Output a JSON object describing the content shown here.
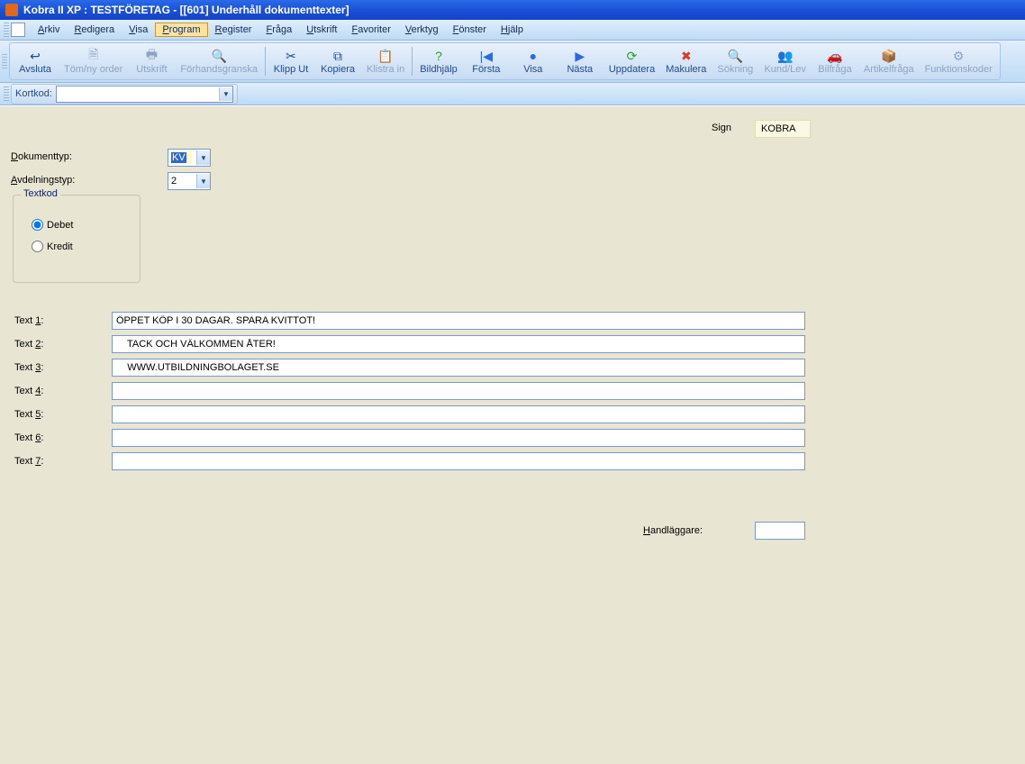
{
  "title": "Kobra II XP : TESTFÖRETAG - [[601] Underhåll dokumenttexter]",
  "menu": {
    "items": [
      "Arkiv",
      "Redigera",
      "Visa",
      "Program",
      "Register",
      "Fråga",
      "Utskrift",
      "Favoriter",
      "Verktyg",
      "Fönster",
      "Hjälp"
    ],
    "selected_index": 3
  },
  "toolbar": [
    {
      "label": "Avsluta",
      "icon": "↩",
      "disabled": false,
      "name": "avsluta"
    },
    {
      "label": "Töm/ny order",
      "icon": "🗎",
      "disabled": true,
      "name": "tom-ny-order"
    },
    {
      "label": "Utskrift",
      "icon": "🖶",
      "disabled": true,
      "name": "utskrift"
    },
    {
      "label": "Förhandsgranska",
      "icon": "🔍",
      "disabled": true,
      "name": "forhandsgranska"
    },
    {
      "sep": true
    },
    {
      "label": "Klipp Ut",
      "icon": "✂",
      "disabled": false,
      "name": "klipp-ut"
    },
    {
      "label": "Kopiera",
      "icon": "⧉",
      "disabled": false,
      "name": "kopiera"
    },
    {
      "label": "Klistra in",
      "icon": "📋",
      "disabled": true,
      "name": "klistra-in"
    },
    {
      "sep": true
    },
    {
      "label": "Bildhjälp",
      "icon": "?",
      "disabled": false,
      "name": "bildhjalp",
      "color": "#2e9e2e"
    },
    {
      "label": "Första",
      "icon": "|◀",
      "disabled": false,
      "name": "forsta",
      "color": "#2a6ae8"
    },
    {
      "label": "Visa",
      "icon": "●",
      "disabled": false,
      "name": "visa",
      "color": "#2a6ae8"
    },
    {
      "label": "Nästa",
      "icon": "▶",
      "disabled": false,
      "name": "nasta",
      "color": "#2a6ae8"
    },
    {
      "label": "Uppdatera",
      "icon": "⟳",
      "disabled": false,
      "name": "uppdatera",
      "color": "#2e9e2e"
    },
    {
      "label": "Makulera",
      "icon": "✖",
      "disabled": false,
      "name": "makulera",
      "color": "#d83a2a"
    },
    {
      "label": "Sökning",
      "icon": "🔍",
      "disabled": true,
      "name": "sokning"
    },
    {
      "label": "Kund/Lev",
      "icon": "👥",
      "disabled": true,
      "name": "kund-lev"
    },
    {
      "label": "Bilfråga",
      "icon": "🚗",
      "disabled": true,
      "name": "bilfraga"
    },
    {
      "label": "Artikelfråga",
      "icon": "📦",
      "disabled": true,
      "name": "artikelfraga"
    },
    {
      "label": "Funktionskoder",
      "icon": "⚙",
      "disabled": true,
      "name": "funktionskoder"
    }
  ],
  "kortkod_label": "Kortkod:",
  "kortkod_value": "",
  "sign_label": "Sign",
  "sign_value": "KOBRA",
  "dokumenttyp_label": "Dokumenttyp:",
  "dokumenttyp_value": "KV",
  "avdelningstyp_label": "Avdelningstyp:",
  "avdelningstyp_value": "2",
  "textkod": {
    "legend": "Textkod",
    "debet": "Debet",
    "kredit": "Kredit",
    "selected": "debet"
  },
  "text_labels": [
    "Text 1:",
    "Text 2:",
    "Text 3:",
    "Text 4:",
    "Text 5:",
    "Text 6:",
    "Text 7:"
  ],
  "text_values": [
    "ÖPPET KÖP I 30 DAGAR. SPARA KVITTOT!",
    "    TACK OCH VÄLKOMMEN ÅTER!",
    "    WWW.UTBILDNINGBOLAGET.SE",
    "",
    "",
    "",
    ""
  ],
  "handlaggare_label": "Handläggare:",
  "handlaggare_value": ""
}
